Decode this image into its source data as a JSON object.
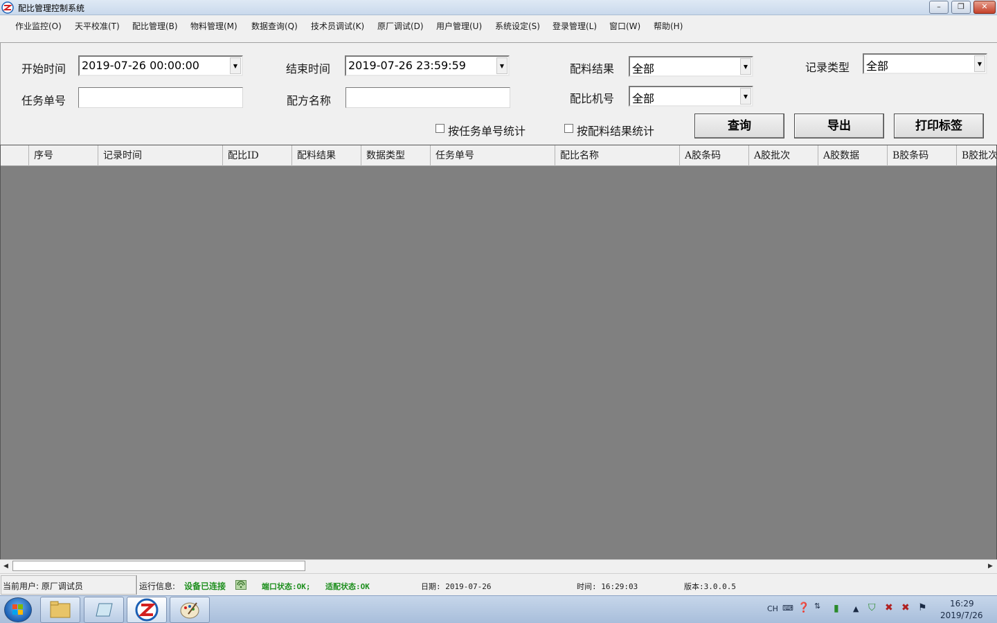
{
  "window": {
    "title": "配比管理控制系统"
  },
  "menu": [
    "作业监控(O)",
    "天平校准(T)",
    "配比管理(B)",
    "物料管理(M)",
    "数据查询(Q)",
    "技术员调试(K)",
    "原厂调试(D)",
    "用户管理(U)",
    "系统设定(S)",
    "登录管理(L)",
    "窗口(W)",
    "帮助(H)"
  ],
  "form": {
    "start_time_label": "开始时间",
    "start_time_value": "2019-07-26 00:00:00",
    "end_time_label": "结束时间",
    "end_time_value": "2019-07-26 23:59:59",
    "result_label": "配料结果",
    "result_value": "全部",
    "record_type_label": "记录类型",
    "record_type_value": "全部",
    "task_no_label": "任务单号",
    "task_no_value": "",
    "recipe_name_label": "配方名称",
    "recipe_name_value": "",
    "machine_no_label": "配比机号",
    "machine_no_value": "全部",
    "by_task_label": "按任务单号统计",
    "by_task_checked": false,
    "by_result_label": "按配料结果统计",
    "by_result_checked": false,
    "query_button": "查询",
    "export_button": "导出",
    "print_button": "打印标签"
  },
  "grid": {
    "columns": [
      "序号",
      "记录时间",
      "配比ID",
      "配料结果",
      "数据类型",
      "任务单号",
      "配比名称",
      "A胶条码",
      "A胶批次",
      "A胶数据",
      "B胶条码",
      "B胶批次"
    ],
    "rows": []
  },
  "status": {
    "current_user": "当前用户: 原厂调试员",
    "run_info_label": "运行信息:",
    "device_status": "设备已连接",
    "port_status": "端口状态:OK;",
    "adapt_status": "适配状态:OK",
    "date": "日期: 2019-07-26",
    "time": "时间: 16:29:03",
    "version": "版本:3.0.0.5"
  },
  "taskbar": {
    "lang": "CH",
    "clock_time": "16:29",
    "clock_date": "2019/7/26"
  },
  "colors": {
    "grid_background": "#808080",
    "status_green": "#1e8f1e",
    "title_bar": "#c9d9ec"
  }
}
